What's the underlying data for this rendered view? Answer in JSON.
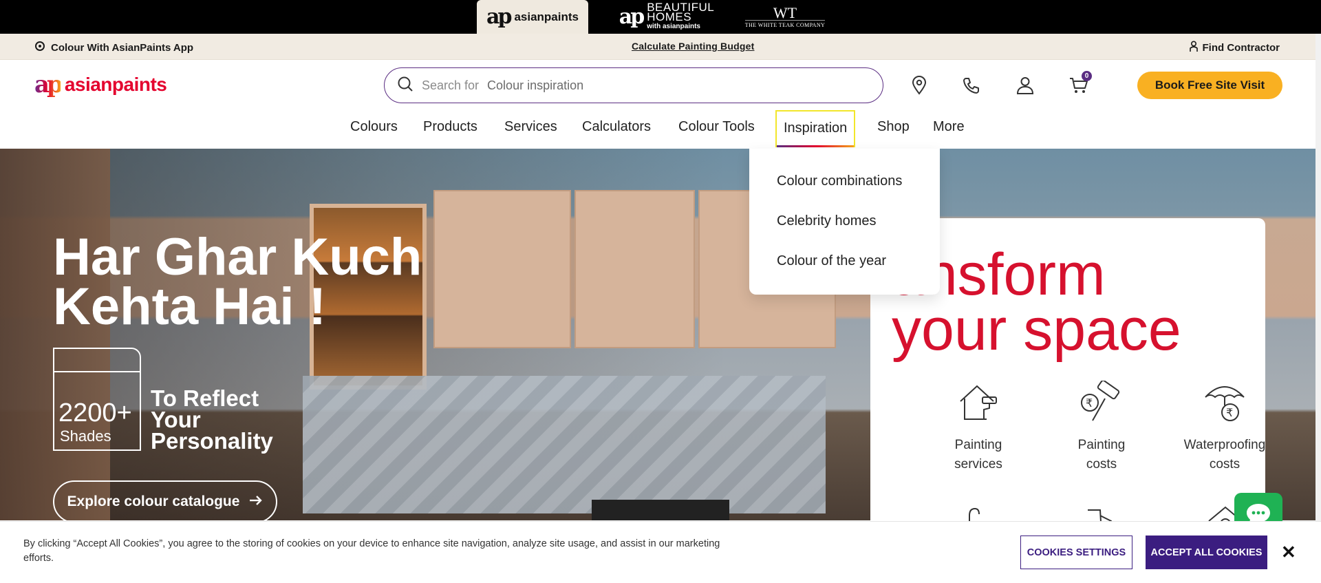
{
  "brand_bar": {
    "tabs": [
      {
        "mark": "ap",
        "name": "asianpaints"
      },
      {
        "mark": "ap",
        "line1": "BEAUTIFUL",
        "line2": "HOMES",
        "line3": "with asianpaints"
      },
      {
        "mark": "WT",
        "name": "THE WHITE TEAK COMPANY"
      }
    ]
  },
  "utility_bar": {
    "app_link": "Colour With AsianPaints App",
    "budget_link": "Calculate Painting Budget",
    "contractor_link": "Find Contractor"
  },
  "header": {
    "logo_mark": "ap",
    "logo_text": "asianpaints",
    "search_prefix": "Search for",
    "search_placeholder": "Colour inspiration",
    "cart_count": "0",
    "book_button": "Book Free Site Visit"
  },
  "nav": {
    "items": [
      "Colours",
      "Products",
      "Services",
      "Calculators",
      "Colour Tools",
      "Inspiration",
      "Shop",
      "More"
    ],
    "active": "Inspiration"
  },
  "dropdown": {
    "items": [
      "Colour combinations",
      "Celebrity homes",
      "Colour of the year"
    ]
  },
  "hero": {
    "title_line1": "Har Ghar Kuch",
    "title_line2": "Kehta Hai !",
    "shades_count": "2200+",
    "shades_label": "Shades",
    "reflect_line1": "To Reflect",
    "reflect_line2": "Your",
    "reflect_line3": "Personality",
    "explore_button": "Explore colour catalogue"
  },
  "transform_card": {
    "title_line1": "ansform",
    "title_line2": "your space",
    "services": [
      {
        "line1": "Painting",
        "line2": "services",
        "icon": "house-roller-icon"
      },
      {
        "line1": "Painting",
        "line2": "costs",
        "icon": "rupee-roller-icon"
      },
      {
        "line1": "Waterproofing",
        "line2": "costs",
        "icon": "umbrella-rupee-icon"
      }
    ]
  },
  "cookie_banner": {
    "text": "By clicking “Accept All Cookies”, you agree to the storing of cookies on your device to enhance site navigation, analyze site usage, and assist in our marketing efforts.",
    "settings_button": "COOKIES SETTINGS",
    "accept_button": "ACCEPT ALL COOKIES",
    "close": "✕"
  },
  "colors": {
    "brand_red": "#d6112e",
    "brand_purple": "#3b1d80",
    "cta_yellow": "#f9b022",
    "util_bg": "#f1ebe2",
    "chat_green": "#1fb254"
  }
}
